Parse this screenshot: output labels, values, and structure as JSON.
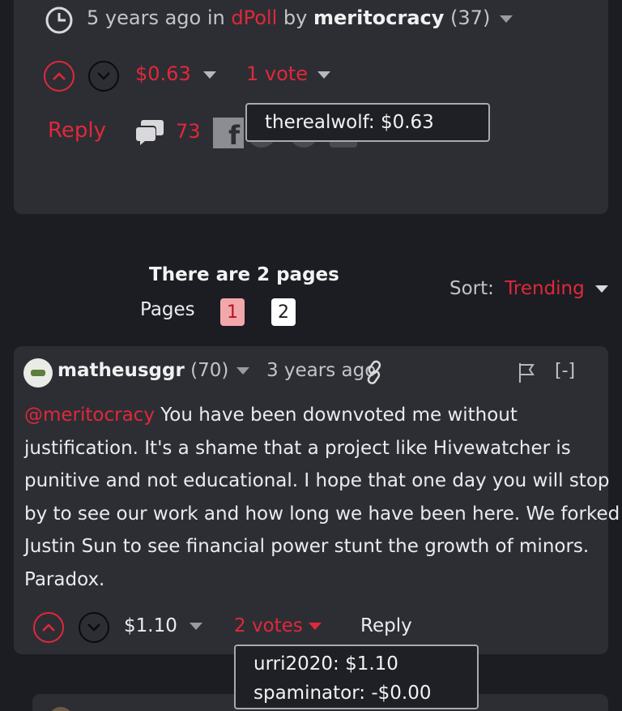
{
  "post": {
    "time": "5 years ago",
    "in_label": "in",
    "community": "dPoll",
    "by_label": "by",
    "author": "meritocracy",
    "reputation": "(37)",
    "payout": "$0.63",
    "votes": "1 vote",
    "reply_label": "Reply",
    "comment_count": "73",
    "tooltip": "therealwolf: $0.63"
  },
  "pagination": {
    "heading": "There are 2 pages",
    "pages_label": "Pages",
    "pages": [
      "1",
      "2"
    ],
    "sort_label": "Sort:",
    "sort_value": "Trending"
  },
  "comment": {
    "author": "matheusggr",
    "reputation": "(70)",
    "time": "3 years ago",
    "collapse_label": "[-]",
    "mention": "@meritocracy",
    "body_lines": [
      " You have been downvoted me without",
      "justification. It's a shame that a project like Hivewatcher is",
      "punitive and not educational. I hope that one day you will stop",
      "by to see our work and how long we have been here. We forked",
      "Justin Sun to see financial power stunt the growth of minors.",
      "Paradox."
    ],
    "payout": "$1.10",
    "votes": "2 votes",
    "reply_label": "Reply",
    "voters": [
      "urri2020: $1.10",
      "spaminator: -$0.00"
    ]
  },
  "colors": {
    "accent": "#e0283b",
    "background": "#1c1d22",
    "card": "#2d2e33"
  }
}
